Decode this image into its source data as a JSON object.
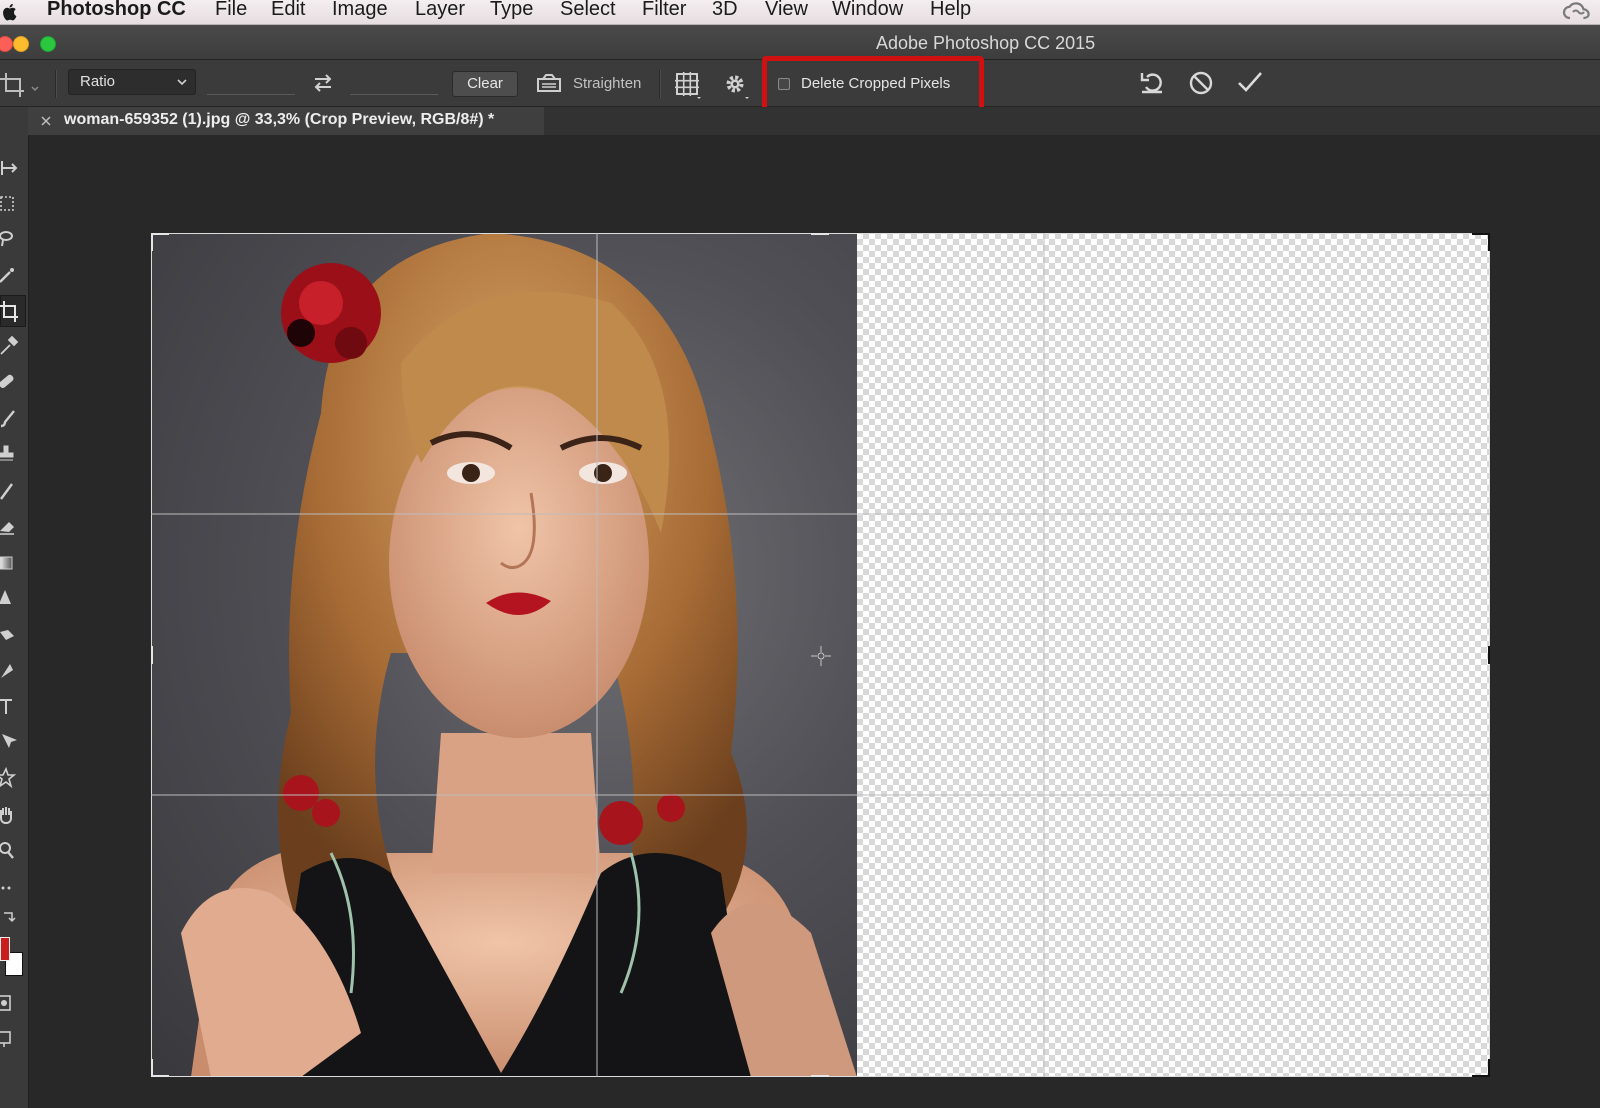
{
  "menubar": {
    "app_name": "Photoshop CC",
    "menus": [
      "File",
      "Edit",
      "Image",
      "Layer",
      "Type",
      "Select",
      "Filter",
      "3D",
      "View",
      "Window",
      "Help"
    ]
  },
  "window": {
    "title": "Adobe Photoshop CC 2015"
  },
  "options_bar": {
    "tool_icon": "crop-icon",
    "ratio_select": "Ratio",
    "width_value": "",
    "height_value": "",
    "swap_icon": "swap-arrows-icon",
    "clear_label": "Clear",
    "straighten_label": "Straighten",
    "overlay_icon": "grid-overlay-icon",
    "settings_icon": "gear-icon",
    "delete_cropped_pixels_label": "Delete Cropped Pixels",
    "delete_cropped_pixels_checked": false,
    "reset_icon": "reset-icon",
    "cancel_icon": "cancel-icon",
    "commit_icon": "checkmark-icon",
    "highlight_color": "#cf1111"
  },
  "document_tab": {
    "title": "woman-659352 (1).jpg @ 33,3% (Crop Preview, RGB/8#) *"
  },
  "toolbox": {
    "tools": [
      "move-tool",
      "marquee-tool",
      "lasso-tool",
      "quick-selection-tool",
      "crop-tool",
      "eyedropper-tool",
      "healing-brush-tool",
      "brush-tool",
      "clone-stamp-tool",
      "history-brush-tool",
      "eraser-tool",
      "gradient-tool",
      "blur-tool",
      "dodge-tool",
      "pen-tool",
      "type-tool",
      "path-selection-tool",
      "shape-tool",
      "hand-tool",
      "zoom-tool",
      "more-tools",
      "swap-colors",
      "foreground-color",
      "background-color",
      "quick-mask",
      "screen-mode"
    ],
    "foreground_color": "#c81e1e",
    "background_color": "#ffffff"
  },
  "canvas": {
    "image_description": "woman portrait photo",
    "transparent_area_pattern": "checkerboard",
    "overlay": "rule-of-thirds"
  }
}
